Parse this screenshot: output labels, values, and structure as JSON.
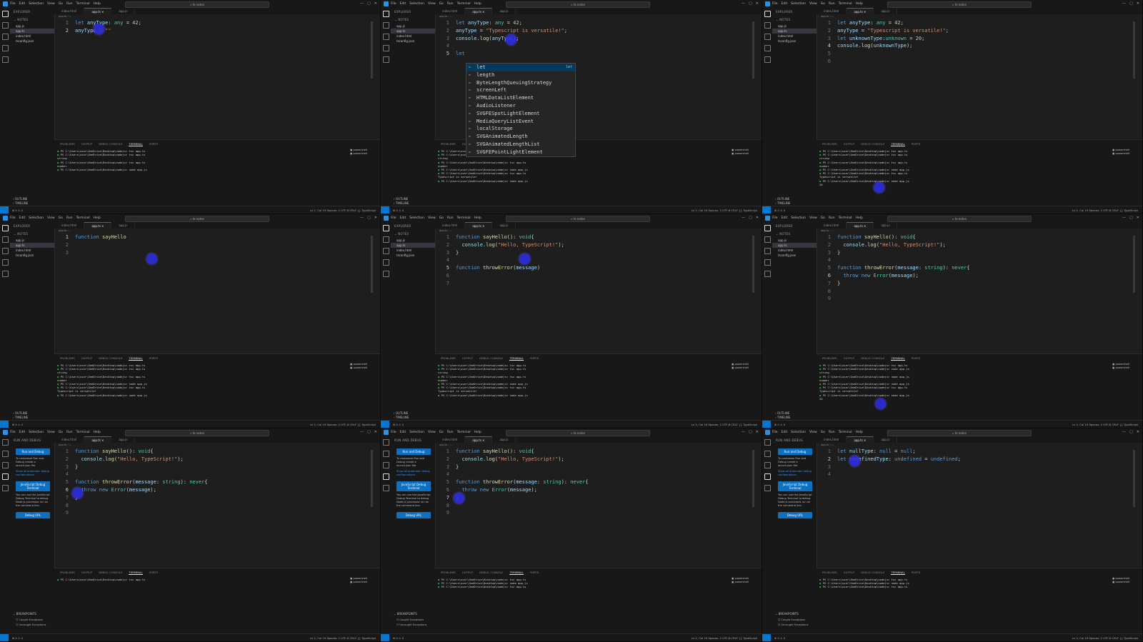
{
  "window": {
    "search": "ts-notes",
    "menu": [
      "File",
      "Edit",
      "Selection",
      "View",
      "Go",
      "Run",
      "Terminal",
      "Help"
    ],
    "tabs": [
      "index.html",
      "app.ts",
      "app.js"
    ],
    "explorer_head": "EXPLORER",
    "folder": "NOTES",
    "files": [
      "app.js",
      "app.ts",
      "index.html",
      "tsconfig.json"
    ],
    "outline": "OUTLINE",
    "timeline": "TIMELINE",
    "panel_tabs": [
      "PROBLEMS",
      "OUTPUT",
      "DEBUG CONSOLE",
      "TERMINAL",
      "PORTS"
    ],
    "terminal_list": [
      "powershell",
      "powershell"
    ],
    "status_right": "Ln 2, Col 19   Spaces: 2   UTF-8   CRLF   {} TypeScript",
    "status_left": "⊗ 0 ⚠ 0"
  },
  "run": {
    "head": "RUN AND DEBUG",
    "button": "Run and Debug",
    "text1": "To customize Run and Debug create a launch.json file.",
    "link1": "Show all automatic debug configurations.",
    "button2": "JavaScript Debug Terminal",
    "text2": "You can use the JavaScript Debug Terminal to debug Node.js processes run on the command line.",
    "button3": "Debug URL",
    "bp_head": "BREAKPOINTS",
    "bp1": "Caught Exceptions",
    "bp2": "Uncaught Exceptions"
  },
  "terminal": {
    "cmd1": "PS C:\\Users\\user\\OneDrive\\Desktop\\nodejs> tsc app.ts",
    "cmd2": "PS C:\\Users\\user\\OneDrive\\Desktop\\nodejs> node app.js",
    "out_string": "string",
    "out_number": "number",
    "out_ts": "Typescript is versatile!",
    "out_20": "20"
  },
  "suggest": {
    "items": [
      "let",
      "length",
      "ByteLengthQueuingStrategy",
      "screenLeft",
      "HTMLDataListElement",
      "AudioListener",
      "SVGFESpotLightElement",
      "MediaQueryListEvent",
      "localStorage",
      "SVGAnimatedLength",
      "SVGAnimatedLengthList",
      "SVGFEPointLightElement"
    ],
    "tag": "let"
  }
}
